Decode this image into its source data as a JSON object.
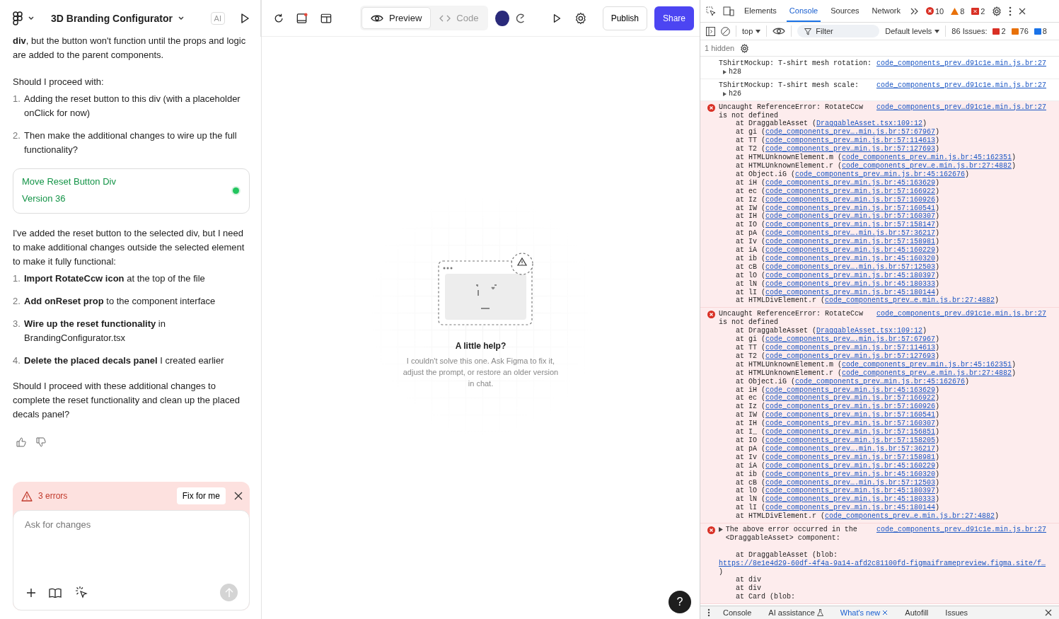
{
  "project": {
    "title": "3D Branding Configurator",
    "ai_label": "AI"
  },
  "view_tabs": [
    {
      "label": "Preview",
      "kind": "preview",
      "selected": true
    },
    {
      "label": "Code",
      "kind": "code",
      "selected": false
    }
  ],
  "actions": {
    "publish": "Publish",
    "share": "Share"
  },
  "chat": {
    "blocks": [
      {
        "kind": "paragraph",
        "text": "**div**, but the button won't function until the props and logic are added to the parent components."
      },
      {
        "kind": "paragraph",
        "text": "Should I proceed with:"
      },
      {
        "kind": "list",
        "items": [
          {
            "number": "1.",
            "text": "Adding the reset button to this div (with a placeholder onClick for now)"
          },
          {
            "number": "2.",
            "text": "Then make the additional changes to wire up the full functionality?"
          }
        ]
      },
      {
        "kind": "version",
        "title": "Move Reset Button Div",
        "subtitle": "Version 36",
        "color": "#22c55e"
      },
      {
        "kind": "paragraph",
        "text": "I've added the reset button to the selected div, but I need to make additional changes outside the selected element to make it fully functional:"
      },
      {
        "kind": "list",
        "items": [
          {
            "number": "1.",
            "text": "**Import RotateCcw icon** at the top of the file"
          },
          {
            "number": "2.",
            "text": "**Add onReset prop** to the component interface"
          },
          {
            "number": "3.",
            "text": "**Wire up the reset functionality** in BrandingConfigurator.tsx"
          },
          {
            "number": "4.",
            "text": "**Delete the placed decals panel** I created earlier"
          }
        ]
      },
      {
        "kind": "paragraph",
        "text": "Should I proceed with these additional changes to complete the reset functionality and clean up the placed decals panel?"
      }
    ],
    "error_banner": {
      "count_label": "3 errors",
      "fix_label": "Fix for me"
    },
    "composer": {
      "placeholder": "Ask for changes"
    }
  },
  "canvas": {
    "title": "A little help?",
    "message": "I couldn't solve this one. Ask Figma to fix it, adjust the prompt, or restore an older version in chat.",
    "help": "?"
  },
  "devtools": {
    "tabs": [
      {
        "label": "Elements",
        "selected": false
      },
      {
        "label": "Console",
        "selected": true
      },
      {
        "label": "Sources",
        "selected": false
      },
      {
        "label": "Network",
        "selected": false
      }
    ],
    "counts": {
      "errors": "10",
      "warnings": "8",
      "issues": "2"
    },
    "context": "top",
    "filter_placeholder": "Filter",
    "levels": "Default levels",
    "issues_label": "86 Issues:",
    "issue_counts": [
      {
        "kind": "error",
        "count": "2"
      },
      {
        "kind": "warning",
        "count": "76"
      },
      {
        "kind": "info",
        "count": "8"
      }
    ],
    "hidden": "1 hidden",
    "messages": [
      {
        "kind": "log",
        "expandable": false,
        "text": "TShirtMockup: T-shirt mesh rotation:",
        "source": "code_components_prev…d91c1e.min.js.br:27",
        "detail": "h28"
      },
      {
        "kind": "log",
        "expandable": false,
        "text": "TShirtMockup: T-shirt mesh scale:",
        "source": "code_components_prev…d91c1e.min.js.br:27",
        "detail": "h26"
      },
      {
        "kind": "error",
        "expandable": false,
        "text": "Uncaught ReferenceError: RotateCcw is not defined",
        "source": "code_components_prev…d91c1e.min.js.br:27",
        "lines": [
          {
            "kind": "frame",
            "text": "at DraggableAsset (",
            "link": "DraggableAsset.tsx:109:12",
            "tail": ")"
          },
          {
            "kind": "frame",
            "text": "at gi (",
            "link": "code_components_prev….min.js.br:57:67967",
            "tail": ")"
          },
          {
            "kind": "frame",
            "text": "at TT (",
            "link": "code_components_prev…min.js.br:57:114613",
            "tail": ")"
          },
          {
            "kind": "frame",
            "text": "at T2 (",
            "link": "code_components_prev…min.js.br:57:127693",
            "tail": ")"
          },
          {
            "kind": "frame",
            "text": "at HTMLUnknownElement.m (",
            "link": "code_components_prev…min.js.br:45:162351",
            "tail": ")"
          },
          {
            "kind": "frame",
            "text": "at HTMLUnknownElement.r (",
            "link": "code_components_prev…e.min.js.br:27:4882",
            "tail": ")"
          },
          {
            "kind": "frame",
            "text": "at Object.iG (",
            "link": "code_components_prev…min.js.br:45:162676",
            "tail": ")"
          },
          {
            "kind": "frame",
            "text": "at iH (",
            "link": "code_components_prev…min.js.br:45:163629",
            "tail": ")"
          },
          {
            "kind": "frame",
            "text": "at ec (",
            "link": "code_components_prev…min.js.br:57:166922",
            "tail": ")"
          },
          {
            "kind": "frame",
            "text": "at Iz (",
            "link": "code_components_prev…min.js.br:57:160926",
            "tail": ")"
          },
          {
            "kind": "frame",
            "text": "at IW (",
            "link": "code_components_prev…min.js.br:57:160541",
            "tail": ")"
          },
          {
            "kind": "frame",
            "text": "at IH (",
            "link": "code_components_prev…min.js.br:57:160307",
            "tail": ")"
          },
          {
            "kind": "frame",
            "text": "at IO (",
            "link": "code_components_prev…min.js.br:57:158147",
            "tail": ")"
          },
          {
            "kind": "frame",
            "text": "at pA (",
            "link": "code_components_prev….min.js.br:57:36217",
            "tail": ")"
          },
          {
            "kind": "frame",
            "text": "at Iv (",
            "link": "code_components_prev…min.js.br:57:158981",
            "tail": ")"
          },
          {
            "kind": "frame",
            "text": "at iA (",
            "link": "code_components_prev…min.js.br:45:160229",
            "tail": ")"
          },
          {
            "kind": "frame",
            "text": "at ib (",
            "link": "code_components_prev…min.js.br:45:160320",
            "tail": ")"
          },
          {
            "kind": "frame",
            "text": "at cB (",
            "link": "code_components_prev….min.js.br:57:12503",
            "tail": ")"
          },
          {
            "kind": "frame",
            "text": "at lO (",
            "link": "code_components_prev…min.js.br:45:180397",
            "tail": ")"
          },
          {
            "kind": "frame",
            "text": "at lN (",
            "link": "code_components_prev…min.js.br:45:180333",
            "tail": ")"
          },
          {
            "kind": "frame",
            "text": "at lI (",
            "link": "code_components_prev…min.js.br:45:180144",
            "tail": ")"
          },
          {
            "kind": "frame",
            "text": "at HTMLDivElement.r (",
            "link": "code_components_prev…e.min.js.br:27:4882",
            "tail": ")"
          }
        ]
      },
      {
        "kind": "error",
        "expandable": false,
        "text": "Uncaught ReferenceError: RotateCcw is not defined",
        "source": "code_components_prev…d91c1e.min.js.br:27",
        "lines": [
          {
            "kind": "frame",
            "text": "at DraggableAsset (",
            "link": "DraggableAsset.tsx:109:12",
            "tail": ")"
          },
          {
            "kind": "frame",
            "text": "at gi (",
            "link": "code_components_prev….min.js.br:57:67967",
            "tail": ")"
          },
          {
            "kind": "frame",
            "text": "at TT (",
            "link": "code_components_prev…min.js.br:57:114613",
            "tail": ")"
          },
          {
            "kind": "frame",
            "text": "at T2 (",
            "link": "code_components_prev…min.js.br:57:127693",
            "tail": ")"
          },
          {
            "kind": "frame",
            "text": "at HTMLUnknownElement.m (",
            "link": "code_components_prev…min.js.br:45:162351",
            "tail": ")"
          },
          {
            "kind": "frame",
            "text": "at HTMLUnknownElement.r (",
            "link": "code_components_prev…e.min.js.br:27:4882",
            "tail": ")"
          },
          {
            "kind": "frame",
            "text": "at Object.iG (",
            "link": "code_components_prev…min.js.br:45:162676",
            "tail": ")"
          },
          {
            "kind": "frame",
            "text": "at iH (",
            "link": "code_components_prev…min.js.br:45:163629",
            "tail": ")"
          },
          {
            "kind": "frame",
            "text": "at ec (",
            "link": "code_components_prev…min.js.br:57:166922",
            "tail": ")"
          },
          {
            "kind": "frame",
            "text": "at Iz (",
            "link": "code_components_prev…min.js.br:57:160926",
            "tail": ")"
          },
          {
            "kind": "frame",
            "text": "at IW (",
            "link": "code_components_prev…min.js.br:57:160541",
            "tail": ")"
          },
          {
            "kind": "frame",
            "text": "at IH (",
            "link": "code_components_prev…min.js.br:57:160307",
            "tail": ")"
          },
          {
            "kind": "frame",
            "text": "at I_ (",
            "link": "code_components_prev…min.js.br:57:156851",
            "tail": ")"
          },
          {
            "kind": "frame",
            "text": "at IO (",
            "link": "code_components_prev…min.js.br:57:158205",
            "tail": ")"
          },
          {
            "kind": "frame",
            "text": "at pA (",
            "link": "code_components_prev….min.js.br:57:36217",
            "tail": ")"
          },
          {
            "kind": "frame",
            "text": "at Iv (",
            "link": "code_components_prev…min.js.br:57:158981",
            "tail": ")"
          },
          {
            "kind": "frame",
            "text": "at iA (",
            "link": "code_components_prev…min.js.br:45:160229",
            "tail": ")"
          },
          {
            "kind": "frame",
            "text": "at ib (",
            "link": "code_components_prev…min.js.br:45:160320",
            "tail": ")"
          },
          {
            "kind": "frame",
            "text": "at cB (",
            "link": "code_components_prev….min.js.br:57:12503",
            "tail": ")"
          },
          {
            "kind": "frame",
            "text": "at lO (",
            "link": "code_components_prev…min.js.br:45:180397",
            "tail": ")"
          },
          {
            "kind": "frame",
            "text": "at lN (",
            "link": "code_components_prev…min.js.br:45:180333",
            "tail": ")"
          },
          {
            "kind": "frame",
            "text": "at lI (",
            "link": "code_components_prev…min.js.br:45:180144",
            "tail": ")"
          },
          {
            "kind": "frame",
            "text": "at HTMLDivElement.r (",
            "link": "code_components_prev…e.min.js.br:27:4882",
            "tail": ")"
          }
        ]
      },
      {
        "kind": "error",
        "expandable": true,
        "text": "The above error occurred in the <DraggableAsset> component:",
        "source": "code_components_prev…d91c1e.min.js.br:27",
        "lines": [
          {
            "kind": "gap"
          },
          {
            "kind": "frame",
            "text": "at DraggableAsset (blob:"
          },
          {
            "kind": "url",
            "link": "https://8e1e4d29-60df-4f4a-9a14-afd2c81100fd-figmaiframepreview.figma.site/f…"
          },
          {
            "kind": "text",
            "text": ")"
          },
          {
            "kind": "frame",
            "text": "at div"
          },
          {
            "kind": "frame",
            "text": "at div"
          },
          {
            "kind": "frame",
            "text": "at Card (blob:"
          }
        ]
      }
    ],
    "drawer_tabs": [
      {
        "label": "Console",
        "kind": "plain",
        "selected": false,
        "closable": false
      },
      {
        "label": "AI assistance",
        "kind": "lab",
        "selected": false,
        "closable": false
      },
      {
        "label": "What's new",
        "kind": "plain",
        "selected": true,
        "closable": true
      },
      {
        "label": "Autofill",
        "kind": "plain",
        "selected": false,
        "closable": false
      },
      {
        "label": "Issues",
        "kind": "plain",
        "selected": false,
        "closable": false
      }
    ]
  }
}
